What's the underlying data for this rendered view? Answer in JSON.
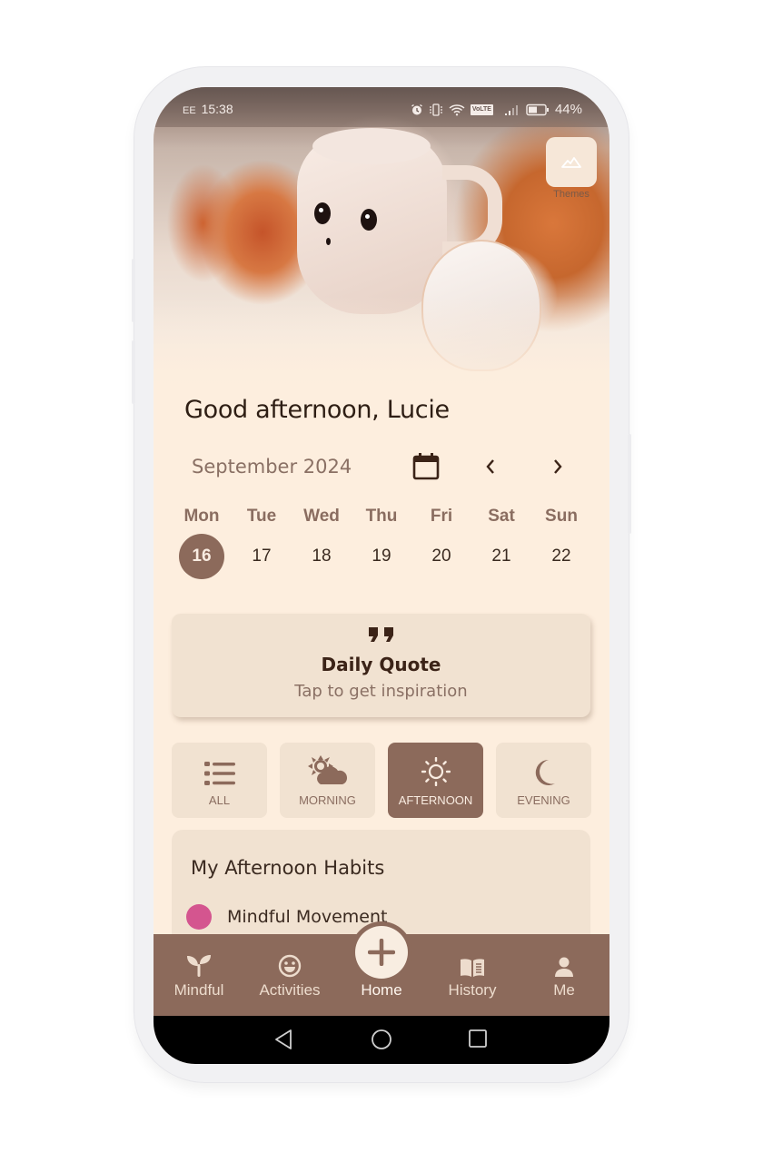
{
  "status_bar": {
    "carrier": "EE",
    "time": "15:38",
    "icons": [
      "alarm-icon",
      "vibrate-icon",
      "wifi-icon",
      "volte-icon",
      "signal-icon",
      "battery-icon"
    ],
    "volte_label": "VoLTE",
    "battery": "44%"
  },
  "header": {
    "themes_label": "Themes",
    "themes_icon": "mountain-icon"
  },
  "greeting": "Good afternoon, Lucie",
  "calendar": {
    "month": "September 2024",
    "weekdays": [
      "Mon",
      "Tue",
      "Wed",
      "Thu",
      "Fri",
      "Sat",
      "Sun"
    ],
    "dates": [
      "16",
      "17",
      "18",
      "19",
      "20",
      "21",
      "22"
    ],
    "selected_date": "16"
  },
  "quote_card": {
    "icon": "”",
    "title": "Daily Quote",
    "subtitle": "Tap to get inspiration"
  },
  "filters": [
    {
      "label": "ALL",
      "icon": "list-icon",
      "active": false
    },
    {
      "label": "MORNING",
      "icon": "sun-cloud-icon",
      "active": false
    },
    {
      "label": "AFTERNOON",
      "icon": "sun-icon",
      "active": true
    },
    {
      "label": "EVENING",
      "icon": "moon-icon",
      "active": false
    }
  ],
  "habits": {
    "title": "My Afternoon Habits",
    "items": [
      {
        "name": "Mindful Movement",
        "color": "#d4558f"
      }
    ]
  },
  "bottom_nav": [
    {
      "label": "Mindful",
      "icon": "sprout-icon"
    },
    {
      "label": "Activities",
      "icon": "smiley-icon"
    },
    {
      "label": "Home",
      "icon": "plus-icon",
      "active": true
    },
    {
      "label": "History",
      "icon": "book-icon"
    },
    {
      "label": "Me",
      "icon": "person-icon"
    }
  ],
  "colors": {
    "accent": "#8c6a5b",
    "background": "#fdeede",
    "card": "#f1e2d1",
    "habit_dot": "#d4558f"
  }
}
